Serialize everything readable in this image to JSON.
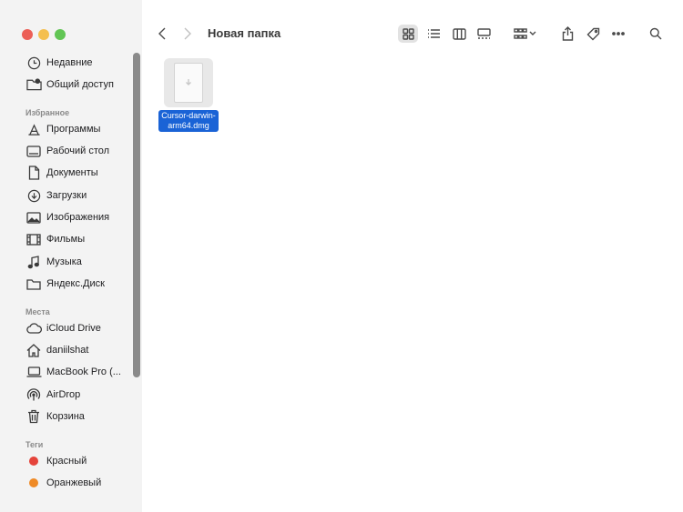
{
  "title": "Новая папка",
  "sidebar": {
    "top": [
      {
        "icon": "clock-icon",
        "label": "Недавние"
      },
      {
        "icon": "shared-folder-icon",
        "label": "Общий доступ"
      }
    ],
    "favorites_header": "Избранное",
    "favorites": [
      {
        "icon": "applications-icon",
        "label": "Программы"
      },
      {
        "icon": "desktop-icon",
        "label": "Рабочий стол"
      },
      {
        "icon": "document-icon",
        "label": "Документы"
      },
      {
        "icon": "download-icon",
        "label": "Загрузки"
      },
      {
        "icon": "photo-icon",
        "label": "Изображения"
      },
      {
        "icon": "film-icon",
        "label": "Фильмы"
      },
      {
        "icon": "music-note-icon",
        "label": "Музыка"
      },
      {
        "icon": "folder-icon",
        "label": "Яндекс.Диск"
      }
    ],
    "locations_header": "Места",
    "locations": [
      {
        "icon": "cloud-icon",
        "label": "iCloud Drive"
      },
      {
        "icon": "home-icon",
        "label": "daniilshat"
      },
      {
        "icon": "laptop-icon",
        "label": "MacBook Pro (..."
      },
      {
        "icon": "airdrop-icon",
        "label": "AirDrop"
      },
      {
        "icon": "trash-icon",
        "label": "Корзина"
      }
    ],
    "tags_header": "Теги",
    "tags": [
      {
        "label": "Красный",
        "color": "#e5443b"
      },
      {
        "label": "Оранжевый",
        "color": "#ef8a26"
      }
    ]
  },
  "file": {
    "name_line1": "Cursor-darwin-",
    "name_line2": "arm64.dmg"
  },
  "colors": {
    "selection": "#1a63d6"
  }
}
